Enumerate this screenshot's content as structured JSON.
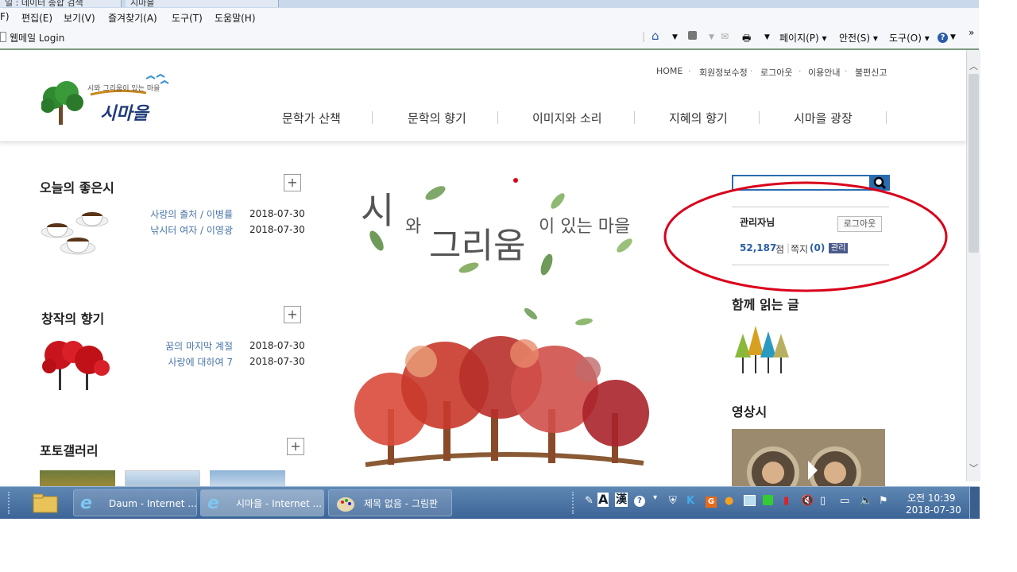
{
  "browser": {
    "tabs": [
      "일 : 데이터 종합 검색",
      "시마을"
    ],
    "menu": [
      "F)",
      "편집(E)",
      "보기(V)",
      "즐겨찾기(A)",
      "도구(T)",
      "도움말(H)"
    ],
    "favorite": "웹메일 Login",
    "toolbar": {
      "page": "페이지(P) ▾",
      "safety": "안전(S) ▾",
      "tools": "도구(O) ▾",
      "more": "»"
    }
  },
  "site": {
    "logo_text": "시마을",
    "logo_tagline": "시와 그리움이 있는 마을",
    "util_links": [
      "HOME",
      "회원정보수정",
      "로그아웃",
      "이용안내",
      "불편신고"
    ],
    "nav": [
      "문학가 산책",
      "문학의 향기",
      "이미지와 소리",
      "지혜의 향기",
      "시마을 광장"
    ]
  },
  "today_poem": {
    "title": "오늘의 좋은시",
    "posts": [
      {
        "title": "사랑의 출처 / 이병률",
        "date": "2018-07-30"
      },
      {
        "title": "낚시터 여자 / 이영광",
        "date": "2018-07-30"
      }
    ]
  },
  "creation": {
    "title": "창작의 향기",
    "posts": [
      {
        "title": "꿈의 마지막 계절",
        "date": "2018-07-30"
      },
      {
        "title": "사랑에 대하여 7",
        "date": "2018-07-30"
      }
    ]
  },
  "gallery": {
    "title": "포토갤러리"
  },
  "hero": {
    "big1": "시",
    "small1": "와",
    "big2": "그리움",
    "small2": "이 있는 마을"
  },
  "sidebar": {
    "search_placeholder": "",
    "user": "관리자님",
    "logout": "로그아웃",
    "points": "52,187",
    "points_unit": "점",
    "memo_label": "쪽지",
    "memo_count": "(0)",
    "admin": "관리",
    "read_together": "함께 읽는 글",
    "video_poem": "영상시"
  },
  "taskbar": {
    "tasks": [
      "Daum - Internet ...",
      "시마을 - Internet ...",
      "제목 없음 - 그림판"
    ],
    "ime": "A",
    "hanja": "漢",
    "ampm": "오전 10:39",
    "date": "2018-07-30"
  },
  "colors": {
    "accent_red": "#d9001b",
    "link": "#4a76a8",
    "admin_badge": "#4a5a8a"
  }
}
